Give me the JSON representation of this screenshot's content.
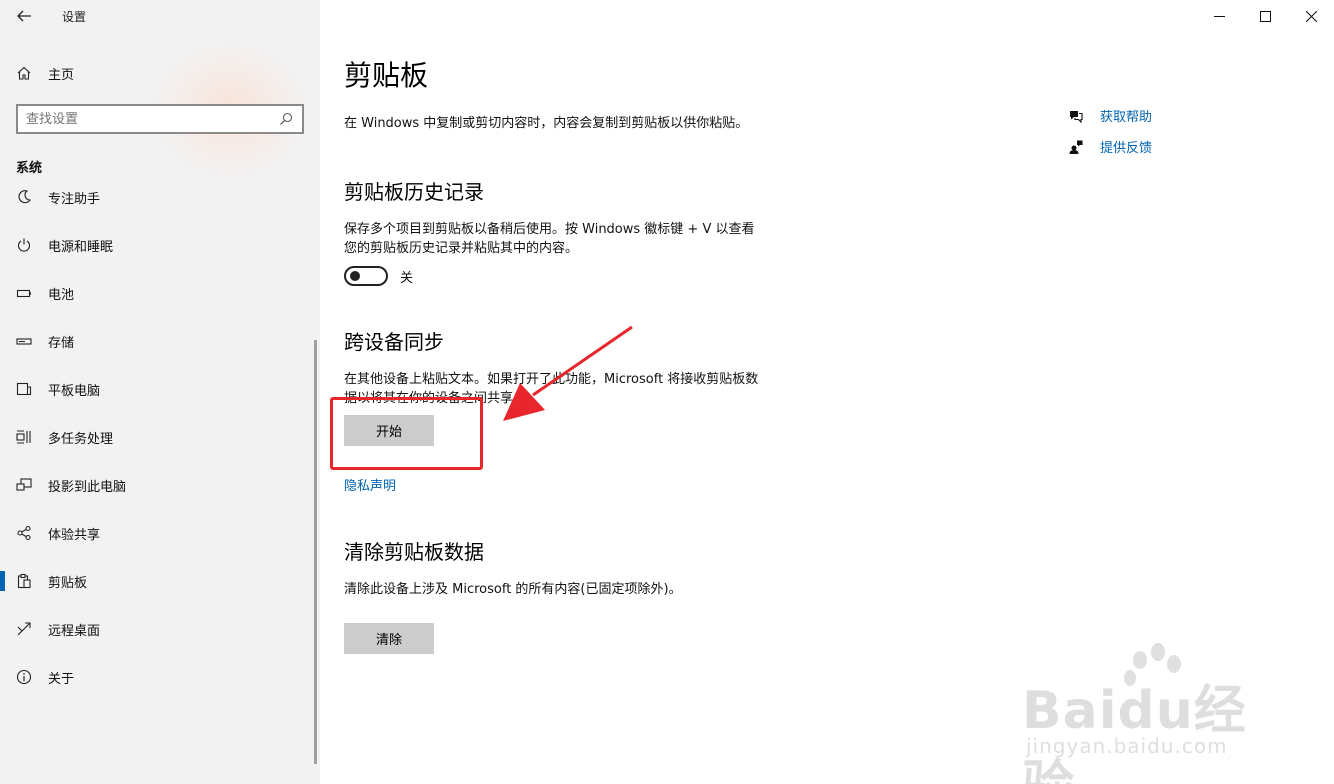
{
  "window": {
    "title": "设置",
    "back_icon": "arrow-left-icon",
    "controls": [
      "minimize-icon",
      "maximize-icon",
      "close-icon"
    ]
  },
  "sidebar": {
    "home_label": "主页",
    "search_placeholder": "查找设置",
    "section_label": "系统",
    "items": [
      {
        "label": "专注助手",
        "icon": "focus-assist-icon"
      },
      {
        "label": "电源和睡眠",
        "icon": "power-icon"
      },
      {
        "label": "电池",
        "icon": "battery-icon"
      },
      {
        "label": "存储",
        "icon": "storage-icon"
      },
      {
        "label": "平板电脑",
        "icon": "tablet-icon"
      },
      {
        "label": "多任务处理",
        "icon": "multitasking-icon"
      },
      {
        "label": "投影到此电脑",
        "icon": "project-icon"
      },
      {
        "label": "体验共享",
        "icon": "share-icon"
      },
      {
        "label": "剪贴板",
        "icon": "clipboard-icon",
        "active": true
      },
      {
        "label": "远程桌面",
        "icon": "remote-desktop-icon"
      },
      {
        "label": "关于",
        "icon": "info-icon"
      }
    ]
  },
  "main": {
    "title": "剪贴板",
    "description": "在 Windows 中复制或剪切内容时，内容会复制到剪贴板以供你粘贴。",
    "history": {
      "heading": "剪贴板历史记录",
      "text_line1": "保存多个项目到剪贴板以备稍后使用。按 Windows 徽标键 + V 以查看",
      "text_line2": "您的剪贴板历史记录并粘贴其中的内容。",
      "toggle_label": "关",
      "toggle_on": false
    },
    "sync": {
      "heading": "跨设备同步",
      "text_line1": "在其他设备上粘贴文本。如果打开了此功能，Microsoft 将接收剪贴板数",
      "text_line2": "据以将其在你的设备之间共享。",
      "button_label": "开始",
      "privacy_link": "隐私声明"
    },
    "clear": {
      "heading": "清除剪贴板数据",
      "text": "清除此设备上涉及 Microsoft 的所有内容(已固定项除外)。",
      "button_label": "清除"
    }
  },
  "help": {
    "get_help": "获取帮助",
    "feedback": "提供反馈"
  },
  "watermark": {
    "brand": "Baidu经验",
    "url": "jingyan.baidu.com"
  },
  "colors": {
    "accent": "#0063b1",
    "annotation": "#e8262b",
    "sidebar_bg": "#f2f2f2",
    "button_bg": "#cccccc"
  }
}
